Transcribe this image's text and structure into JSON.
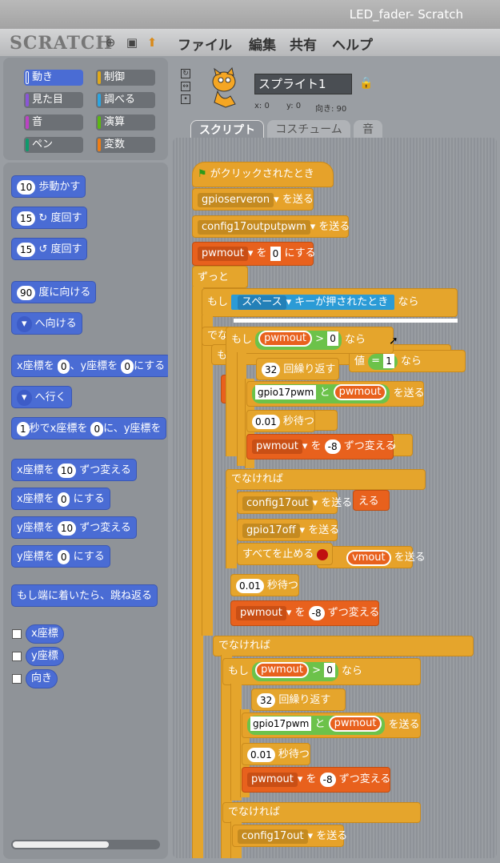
{
  "window": {
    "title": "LED_fader- Scratch"
  },
  "menu": {
    "logo": "SCRATCH",
    "file": "ファイル",
    "edit": "編集",
    "share": "共有",
    "help": "ヘルプ"
  },
  "categories": [
    {
      "label": "動き",
      "color": "#4a6cd4"
    },
    {
      "label": "制御",
      "color": "#e1a91a"
    },
    {
      "label": "見た目",
      "color": "#8a55d7"
    },
    {
      "label": "調べる",
      "color": "#2ca5e2"
    },
    {
      "label": "音",
      "color": "#bb42c3"
    },
    {
      "label": "演算",
      "color": "#5cb712"
    },
    {
      "label": "ペン",
      "color": "#0e9a6c"
    },
    {
      "label": "変数",
      "color": "#ee7d16"
    }
  ],
  "palette": {
    "move_n": "10",
    "move": "歩動かす",
    "turn_r_n": "15",
    "turn_r": "度回す",
    "turn_l_n": "15",
    "turn_l": "度回す",
    "point_n": "90",
    "point": "度に向ける",
    "point_to": "へ向ける",
    "goto_xy_a": "x座標を",
    "goto_xy_x": "0",
    "goto_xy_b": "、y座標を",
    "goto_xy_y": "0",
    "goto_xy_c": "にする",
    "goto": "へ行く",
    "glide_n": "1",
    "glide_a": "秒でx座標を",
    "glide_x": "0",
    "glide_b": "に、y座標を",
    "chx_a": "x座標を",
    "chx_n": "10",
    "chx_b": "ずつ変える",
    "setx_a": "x座標を",
    "setx_n": "0",
    "setx_b": "にする",
    "chy_a": "y座標を",
    "chy_n": "10",
    "chy_b": "ずつ変える",
    "sety_a": "y座標を",
    "sety_n": "0",
    "sety_b": "にする",
    "bounce": "もし端に着いたら、跳ね返る",
    "rep_x": "x座標",
    "rep_y": "y座標",
    "rep_dir": "向き"
  },
  "sprite": {
    "name": "スプライト1",
    "x_label": "x: 0",
    "y_label": "y: 0",
    "dir_label": "向き: 90"
  },
  "tabs": {
    "scripts": "スクリプト",
    "costumes": "コスチューム",
    "sounds": "音"
  },
  "script": {
    "hat": "がクリックされたとき",
    "b1_msg": "gpioserveron",
    "b1": "を送る",
    "b2_msg": "config17outputpwm",
    "b2": "を送る",
    "b3_var": "pwmout",
    "b3_a": "を",
    "b3_val": "0",
    "b3_b": "にする",
    "forever": "ずっと",
    "if1_a": "もし",
    "if1_key": "スペース",
    "if1_b": "キーが押されたとき",
    "if1_c": "なら",
    "else1": "でなけれ",
    "if2_a": "もし",
    "if2_var": "pwmout",
    "if2_op": ">",
    "if2_val": "0",
    "if2_c": "なら",
    "hidden_val": "1",
    "hidden_eq": "=",
    "hidden_naru": "なら",
    "hidden_chi": "値",
    "rep1_n": "32",
    "rep1": "回繰り返す",
    "send1_s": "gpio17pwm",
    "send1_and": "と",
    "send1_var": "pwmout",
    "send1": "を送る",
    "wait1_n": "0.01",
    "wait1": "秒待つ",
    "chg1_var": "pwmout",
    "chg1_a": "を",
    "chg1_n": "-8",
    "chg1_b": "ずつ変える",
    "else2": "でなければ",
    "cfg_msg": "config17out",
    "cfg": "を送る",
    "off_msg": "gpio17off",
    "off": "を送る",
    "stop": "すべてを止める",
    "wait2_n": "0.01",
    "wait2": "秒待つ",
    "chg2_var": "pwmout",
    "chg2_a": "を",
    "chg2_n": "-8",
    "chg2_b": "ずつ変える",
    "else3": "でなければ",
    "if3_a": "もし",
    "if3_var": "pwmout",
    "if3_op": ">",
    "if3_val": "0",
    "if3_c": "なら",
    "rep2_n": "32",
    "rep2": "回繰り返す",
    "send2_s": "gpio17pwm",
    "send2_and": "と",
    "send2_var": "pwmout",
    "send2": "を送る",
    "wait3_n": "0.01",
    "wait3": "秒待つ",
    "chg3_var": "pwmout",
    "chg3_a": "を",
    "chg3_n": "-8",
    "chg3_b": "ずつ変える",
    "else4": "でなければ",
    "cfg2_msg": "config17out",
    "cfg2": "を送る",
    "ghost_v": "vmout",
    "ghost_send": "を送る",
    "ghost_ru": "える",
    "ghost_ru2": "る",
    "ghost_su": "す",
    "ghost_mo": "も"
  }
}
